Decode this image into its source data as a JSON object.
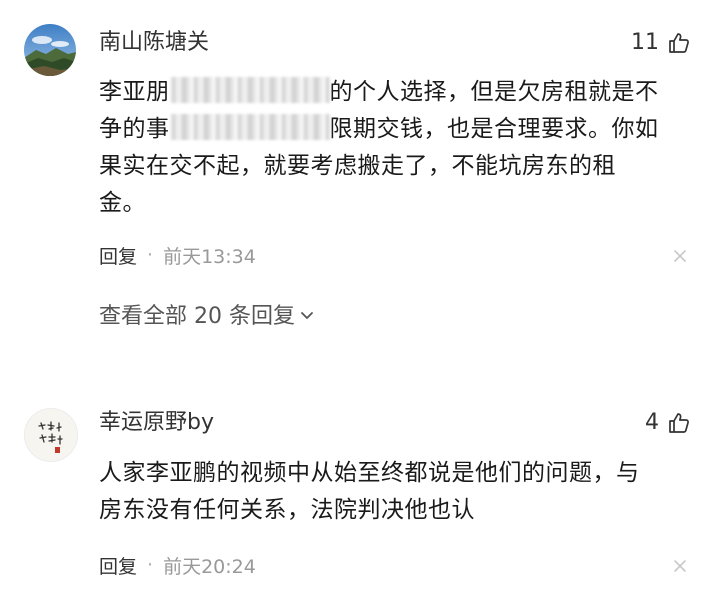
{
  "comments": [
    {
      "username": "南山陈塘关",
      "likes": "11",
      "text_line1_a": "李亚朋",
      "text_line1_b": "的个人选择，但是欠房租就是不",
      "text_line2_a": "争的事",
      "text_line2_b": "限期交钱，也是合理要求。你如",
      "text_line3": "果实在交不起，就要考虑搬走了，不能坑房东的租",
      "text_line4": "金。",
      "reply_label": "回复",
      "separator": "·",
      "time": "前天13:34",
      "view_all": "查看全部 20 条回复"
    },
    {
      "username": "幸运原野by",
      "likes": "4",
      "text_line1": "人家李亚鹏的视频中从始至终都说是他们的问题，与",
      "text_line2": "房东没有任何关系，法院判决他也认",
      "reply_label": "回复",
      "separator": "·",
      "time": "前天20:24"
    }
  ],
  "icons": {
    "like": "thumbs-up-icon",
    "close": "close-icon",
    "chevron": "chevron-down-icon"
  },
  "colors": {
    "text_primary": "#1a1a1a",
    "text_secondary": "#999999",
    "username": "#333333"
  }
}
